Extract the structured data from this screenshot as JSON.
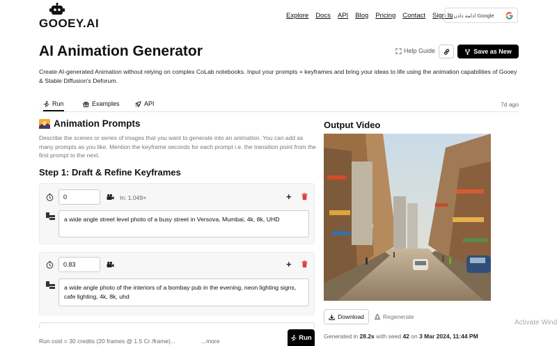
{
  "logo": {
    "text": "GOOEY.AI"
  },
  "nav": [
    "Explore",
    "Docs",
    "API",
    "Blog",
    "Pricing",
    "Contact",
    "Sign In"
  ],
  "google_btn": {
    "label": "ادامه دادن با Google"
  },
  "page": {
    "title": "AI Animation Generator",
    "help_label": "Help Guide",
    "save_label": "Save as New",
    "description": "Create AI-generated Animation without relying on complex CoLab notebooks. Input your prompts + keyframes and bring your ideas to life using the animation capabilities of Gooey & Stable Diffusion's Deforum."
  },
  "tabs": [
    {
      "label": "Run",
      "active": true
    },
    {
      "label": "Examples",
      "active": false
    },
    {
      "label": "API",
      "active": false
    }
  ],
  "tab_time": "7d ago",
  "prompts": {
    "title": "Animation Prompts",
    "description": "Describe the scenes or series of images that you want to generate into an animation. You can add as many prompts as you like. Mention the keyframe seconds for each prompt i.e. the transition point from the first prompt to the next.",
    "step_title": "Step 1: Draft & Refine Keyframes"
  },
  "keyframes": [
    {
      "frame": "0",
      "zoom": "In: 1.049×",
      "prompt": "a wide angle street level photo of a busy street in Versova, Mumbai, 4k, 8k, UHD"
    },
    {
      "frame": "0.83",
      "zoom": "",
      "prompt": "a wide angle photo of the interiors of a bombay pub in the evening, neon lighting signs, cafe lighting, 4k, 8k, uhd"
    }
  ],
  "run": {
    "cost_prefix": "Run cost = ",
    "credits": "30 credits",
    "cost_suffix": " (20 frames @ 1.5 Cr /frame)...",
    "more": "...more",
    "button": "Run"
  },
  "output": {
    "title": "Output Video",
    "download": "Download",
    "regenerate": "Regenerate",
    "gen_prefix": "Generated in ",
    "gen_time": "28.2s",
    "gen_seed_prefix": " with seed ",
    "seed": "42",
    "gen_on": " on ",
    "date": "3 Mar 2024, 11:44 PM"
  },
  "watermark": "Activate Wind"
}
